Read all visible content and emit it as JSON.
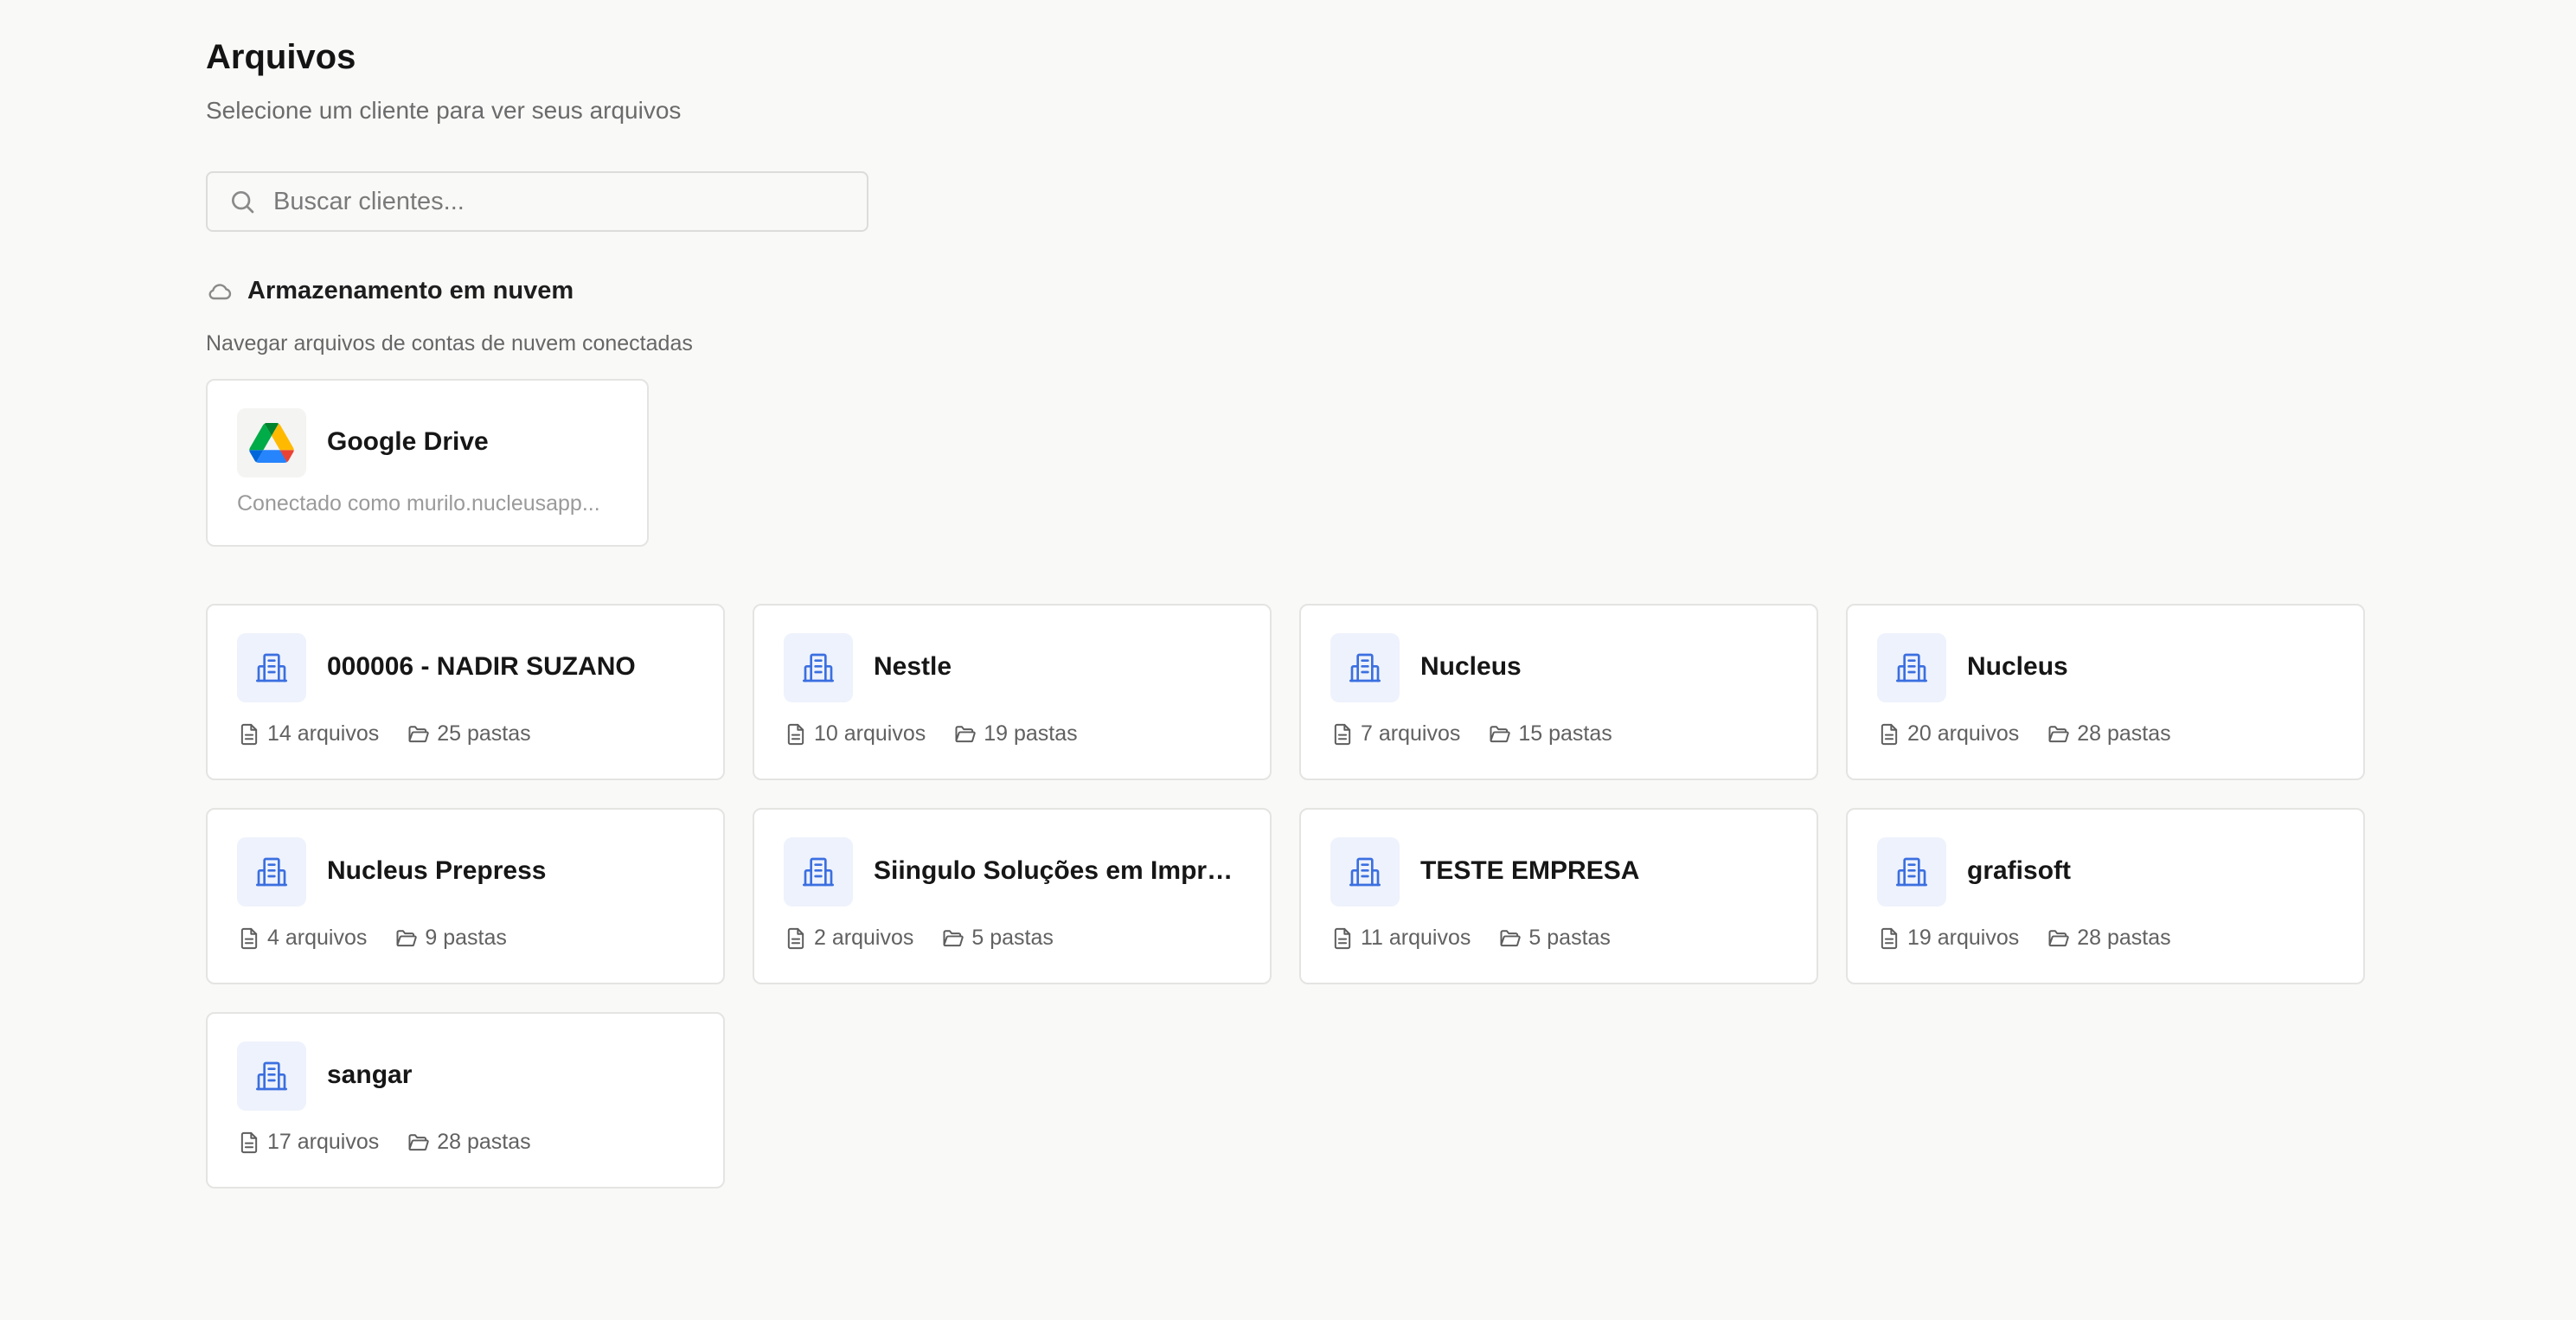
{
  "header": {
    "title": "Arquivos",
    "subtitle": "Selecione um cliente para ver seus arquivos"
  },
  "search": {
    "placeholder": "Buscar clientes...",
    "value": ""
  },
  "cloud_storage": {
    "heading": "Armazenamento em nuvem",
    "description": "Navegar arquivos de contas de nuvem conectadas",
    "providers": [
      {
        "name": "Google Drive",
        "status": "Conectado como murilo.nucleusapp...",
        "icon": "google-drive-icon"
      }
    ]
  },
  "clients": [
    {
      "name": "000006 - NADIR SUZANO",
      "files": "14 arquivos",
      "folders": "25 pastas"
    },
    {
      "name": "Nestle",
      "files": "10 arquivos",
      "folders": "19 pastas"
    },
    {
      "name": "Nucleus",
      "files": "7 arquivos",
      "folders": "15 pastas"
    },
    {
      "name": "Nucleus",
      "files": "20 arquivos",
      "folders": "28 pastas"
    },
    {
      "name": "Nucleus Prepress",
      "files": "4 arquivos",
      "folders": "9 pastas"
    },
    {
      "name": "Siingulo Soluções em Impres...",
      "files": "2 arquivos",
      "folders": "5 pastas"
    },
    {
      "name": "TESTE EMPRESA",
      "files": "11 arquivos",
      "folders": "5 pastas"
    },
    {
      "name": "grafisoft",
      "files": "19 arquivos",
      "folders": "28 pastas"
    },
    {
      "name": "sangar",
      "files": "17 arquivos",
      "folders": "28 pastas"
    }
  ],
  "icons": {
    "client": "building-icon",
    "files": "file-icon",
    "folders": "folder-icon",
    "search": "search-icon",
    "cloud": "cloud-icon"
  },
  "colors": {
    "accent": "#3b6fe0",
    "badge_bg": "#eef2fc",
    "background": "#f9f9f8"
  }
}
